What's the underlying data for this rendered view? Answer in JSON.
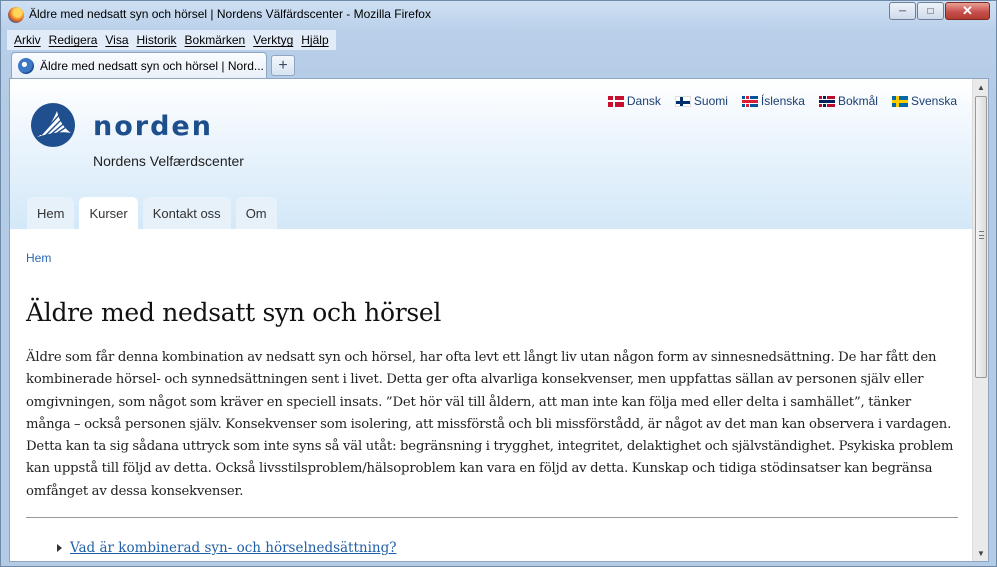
{
  "window": {
    "title": "Äldre med nedsatt syn och hörsel | Nordens Välfärdscenter - Mozilla Firefox",
    "minimize_icon": "minimize-icon",
    "maximize_icon": "maximize-icon",
    "close_icon": "close-icon"
  },
  "menubar": {
    "items": [
      "Arkiv",
      "Redigera",
      "Visa",
      "Historik",
      "Bokmärken",
      "Verktyg",
      "Hjälp"
    ]
  },
  "tabs": {
    "active_label": "Äldre med nedsatt syn och hörsel | Nord...",
    "new_tab_label": "+"
  },
  "site": {
    "logo_text": "norden",
    "subtitle": "Nordens Velfærdscenter",
    "languages": [
      {
        "label": "Dansk",
        "flag": "dk"
      },
      {
        "label": "Suomi",
        "flag": "fi"
      },
      {
        "label": "Íslenska",
        "flag": "is"
      },
      {
        "label": "Bokmål",
        "flag": "no"
      },
      {
        "label": "Svenska",
        "flag": "se"
      }
    ],
    "nav": [
      {
        "label": "Hem",
        "active": false
      },
      {
        "label": "Kurser",
        "active": true
      },
      {
        "label": "Kontakt oss",
        "active": false
      },
      {
        "label": "Om",
        "active": false
      }
    ]
  },
  "content": {
    "breadcrumb": "Hem",
    "title": "Äldre med nedsatt syn och hörsel",
    "body": "Äldre som får denna kombination av nedsatt syn och hörsel, har ofta levt ett långt liv utan någon form av sinnesnedsättning. De har fått den kombinerade hörsel- och synnedsättningen sent i livet. Detta ger ofta alvarliga konsekvenser, men uppfattas sällan av personen själv eller omgivningen, som något som kräver en speciell insats. ”Det hör väl till åldern, att man inte kan följa med eller delta i samhället”, tänker många – också personen själv. Konsekvenser som isolering, att missförstå och bli missförstådd, är något av det man kan observera i vardagen. Detta kan ta sig sådana uttryck som inte syns så väl utåt: begränsning i trygghet, integritet, delaktighet och självständighet. Psykiska problem kan uppstå till följd av detta. Också livsstilsproblem/hälsoproblem kan vara en följd av detta. Kunskap och tidiga stödinsatser kan begränsa omfånget av dessa konsekvenser.",
    "toggle_link": "Vad är kombinerad syn- och hörselnedsättning?"
  },
  "colors": {
    "link": "#2a6ab1",
    "logo": "#1c4f8c",
    "header_gradient_end": "#d3e8f8"
  }
}
